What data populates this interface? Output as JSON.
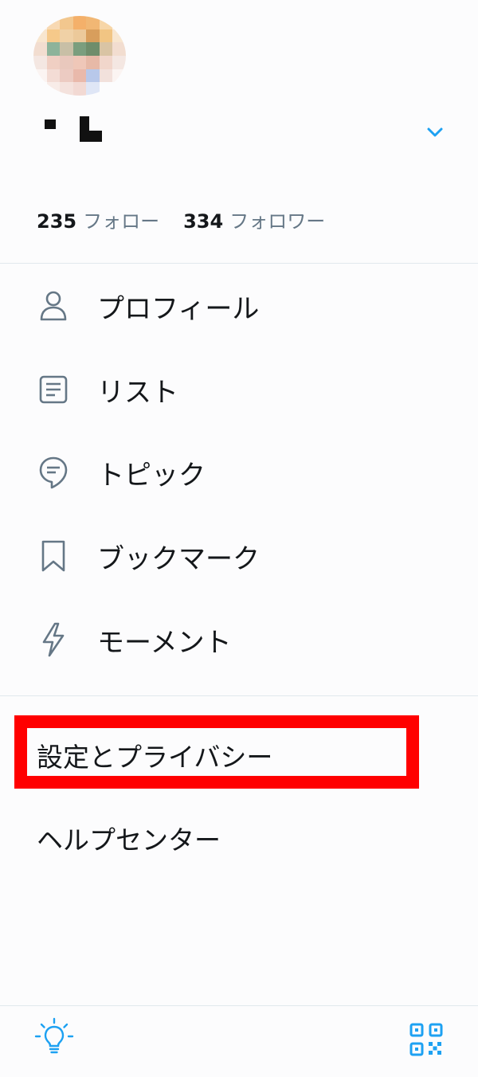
{
  "profile": {
    "avatar_icon": "user-avatar-pixelated",
    "name_redacted": true
  },
  "stats": {
    "following_count": "235",
    "following_label": "フォロー",
    "followers_count": "334",
    "followers_label": "フォロワー"
  },
  "menu": [
    {
      "label": "プロフィール",
      "icon": "person-icon"
    },
    {
      "label": "リスト",
      "icon": "list-icon"
    },
    {
      "label": "トピック",
      "icon": "topic-icon"
    },
    {
      "label": "ブックマーク",
      "icon": "bookmark-icon"
    },
    {
      "label": "モーメント",
      "icon": "lightning-icon"
    }
  ],
  "secondary": {
    "settings_label": "設定とプライバシー",
    "help_label": "ヘルプセンター"
  },
  "bottom": {
    "left_icon": "lightbulb-icon",
    "right_icon": "qr-code-icon"
  },
  "colors": {
    "accent": "#1da1f2",
    "highlight": "#ff0000",
    "muted": "#657786"
  }
}
